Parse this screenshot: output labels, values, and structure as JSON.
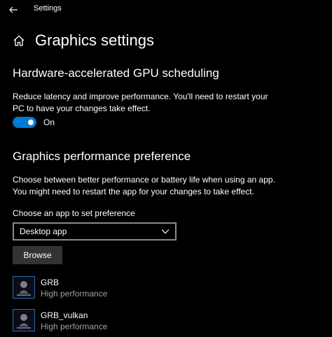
{
  "window": {
    "title": "Settings"
  },
  "header": {
    "title": "Graphics settings"
  },
  "gpu_scheduling": {
    "title": "Hardware-accelerated GPU scheduling",
    "description_line1": "Reduce latency and improve performance. You'll need to restart your",
    "description_line2": "PC to have your changes take effect.",
    "toggle_state": "On",
    "toggle_on": true
  },
  "performance_preference": {
    "title": "Graphics performance preference",
    "description_line1": "Choose between better performance or battery life when using an app.",
    "description_line2": "You might need to restart the app for your changes to take effect.",
    "choose_label": "Choose an app to set preference",
    "dropdown_value": "Desktop app",
    "browse_label": "Browse"
  },
  "apps": [
    {
      "name": "GRB",
      "preference": "High performance"
    },
    {
      "name": "GRB_vulkan",
      "preference": "High performance"
    }
  ],
  "colors": {
    "accent": "#0078d4",
    "background": "#000000",
    "secondary_text": "#a0a0a0",
    "button": "#333333"
  }
}
